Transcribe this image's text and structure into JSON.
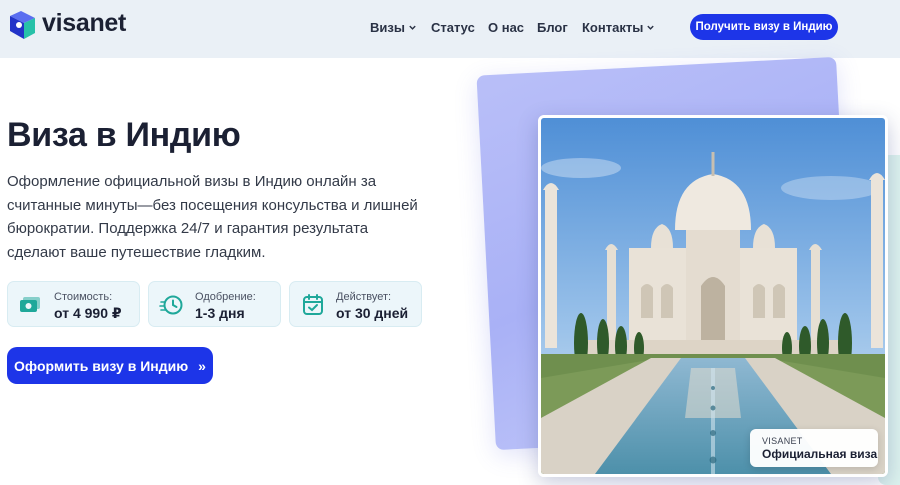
{
  "header": {
    "logo_text": "visanet",
    "nav": [
      {
        "label": "Визы",
        "has_dropdown": true
      },
      {
        "label": "Статус",
        "has_dropdown": false
      },
      {
        "label": "О нас",
        "has_dropdown": false
      },
      {
        "label": "Блог",
        "has_dropdown": false
      },
      {
        "label": "Контакты",
        "has_dropdown": true
      }
    ],
    "cta_label": "Получить визу в Индию"
  },
  "hero": {
    "title": "Виза в Индию",
    "description": "Оформление официальной визы в Индию онлайн за считанные минуты—без посещения консульства и лишней бюрократии. Поддержка 24/7 и гарантия результата сделают ваше путешествие гладким.",
    "stats": [
      {
        "icon": "money-icon",
        "label": "Стоимость:",
        "value": "от 4 990 ₽"
      },
      {
        "icon": "clock-icon",
        "label": "Одобрение:",
        "value": "1-3 дня"
      },
      {
        "icon": "calendar-check-icon",
        "label": "Действует:",
        "value": "от 30 дней"
      }
    ],
    "cta_label": "Оформить визу в Индию",
    "cta_arrow": "»"
  },
  "photo_badge": {
    "small": "VISANET",
    "big": "Официальная виза"
  },
  "colors": {
    "accent": "#1d35e8",
    "header_bg": "#eaf0f6",
    "stat_bg": "#ecf6fa",
    "stat_icon": "#1fa89a"
  }
}
